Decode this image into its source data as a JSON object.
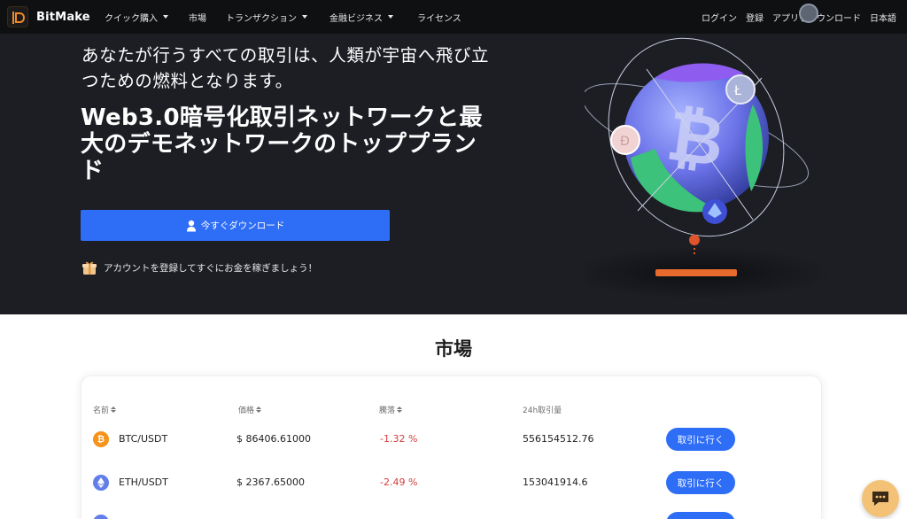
{
  "nav": {
    "brand": "BitMake",
    "items": [
      {
        "label": "クイック購入",
        "dropdown": true
      },
      {
        "label": "市場",
        "dropdown": false
      },
      {
        "label": "トランザクション",
        "dropdown": true
      },
      {
        "label": "金融ビジネス",
        "dropdown": true
      },
      {
        "label": "ライセンス",
        "dropdown": false
      }
    ],
    "login": "ログイン",
    "register": "登録",
    "download_app": "アプリをダウンロード",
    "language": "日本語"
  },
  "hero": {
    "subtitle": "あなたが行うすべての取引は、人類が宇宙へ飛び立つための燃料となります。",
    "title": "Web3.0暗号化取引ネットワークと最大のデモネットワークのトッププランド",
    "download_button": "今すぐダウンロード",
    "promo_text": "アカウントを登録してすぐにお金を稼ぎましょう！"
  },
  "market": {
    "title": "市場",
    "columns": [
      "名前",
      "価格",
      "騰落",
      "24h取引量"
    ],
    "rows": [
      {
        "pair": "BTC/USDT",
        "icon": "bitcoin-icon",
        "icon_color": "#f7931a",
        "price": "$ 86406.61000",
        "change": "-1.32 %",
        "volume": "556154512.76",
        "action": "取引に行く"
      },
      {
        "pair": "ETH/USDT",
        "icon": "ethereum-icon",
        "icon_color": "#627eea",
        "price": "$ 2367.65000",
        "change": "-2.49 %",
        "volume": "153041914.6",
        "action": "取引に行く"
      }
    ]
  },
  "colors": {
    "accent": "#2e6df6",
    "negative": "#d93a3a",
    "hero_bg": "#1c1e24"
  }
}
